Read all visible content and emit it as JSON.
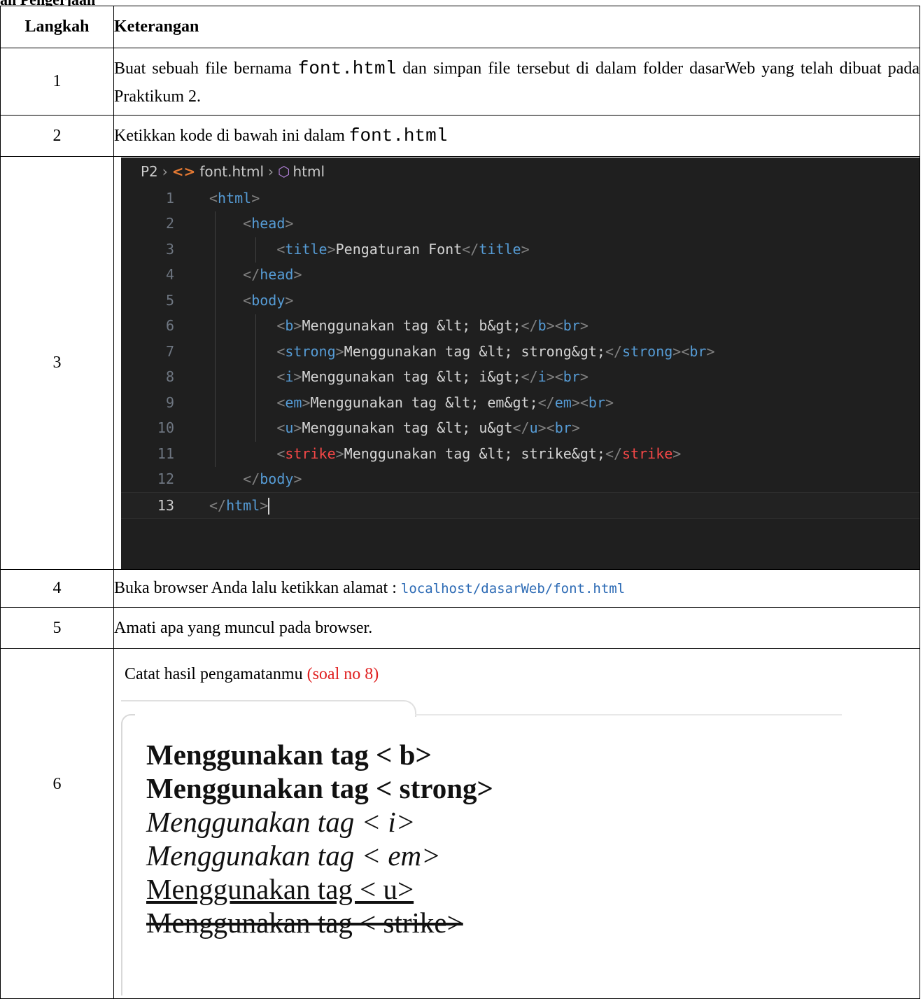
{
  "header": {
    "cut_title": "ah Pengerjaan"
  },
  "table": {
    "col_step": "Langkah",
    "col_desc": "Keterangan",
    "row1": {
      "num": "1",
      "a": "Buat sebuah file bernama ",
      "code": "font.html",
      "b": " dan simpan file tersebut di dalam folder dasarWeb yang telah dibuat pada Praktikum 2."
    },
    "row2": {
      "num": "2",
      "a": "Ketikkan kode di bawah ini dalam ",
      "code": "font.html"
    },
    "row3": {
      "num": "3"
    },
    "row4": {
      "num": "4",
      "a": "Buka browser Anda lalu ketikkan alamat : ",
      "url": "localhost/dasarWeb/font.html"
    },
    "row5": {
      "num": "5",
      "a": "Amati apa yang muncul pada browser."
    },
    "row6": {
      "num": "6",
      "a": "Catat hasil pengamatanmu ",
      "note": "(soal no 8)"
    }
  },
  "editor": {
    "breadcrumb": {
      "folder": "P2",
      "file": "font.html",
      "symbol": "html"
    },
    "lines": [
      "1",
      "2",
      "3",
      "4",
      "5",
      "6",
      "7",
      "8",
      "9",
      "10",
      "11",
      "12",
      "13"
    ],
    "code": {
      "l1_tag": "html",
      "l2_tag": "head",
      "l3_open": "title",
      "l3_text": "Pengaturan Font",
      "l3_close": "title",
      "l4_tag": "head",
      "l5_tag": "body",
      "l6_open": "b",
      "l6_text": "Menggunakan tag &lt; b&gt;",
      "l6_close": "b",
      "l6_br": "br",
      "l7_open": "strong",
      "l7_text": "Menggunakan tag &lt; strong&gt;",
      "l7_close": "strong",
      "l7_br": "br",
      "l8_open": "i",
      "l8_text": "Menggunakan tag &lt; i&gt;",
      "l8_close": "i",
      "l8_br": "br",
      "l9_open": "em",
      "l9_text": "Menggunakan tag &lt; em&gt;",
      "l9_close": "em",
      "l9_br": "br",
      "l10_open": "u",
      "l10_text": "Menggunakan tag &lt; u&gt",
      "l10_close": "u",
      "l10_br": "br",
      "l11_open": "strike",
      "l11_text": "Menggunakan tag &lt; strike&gt;",
      "l11_close": "strike",
      "l12_tag": "body",
      "l13_tag": "html"
    }
  },
  "preview": {
    "b": "Menggunakan tag < b>",
    "strong": "Menggunakan tag < strong>",
    "i": "Menggunakan tag < i>",
    "em": "Menggunakan tag < em>",
    "u": "Menggunakan tag < u>",
    "strike": "Menggunakan tag < strike>"
  }
}
